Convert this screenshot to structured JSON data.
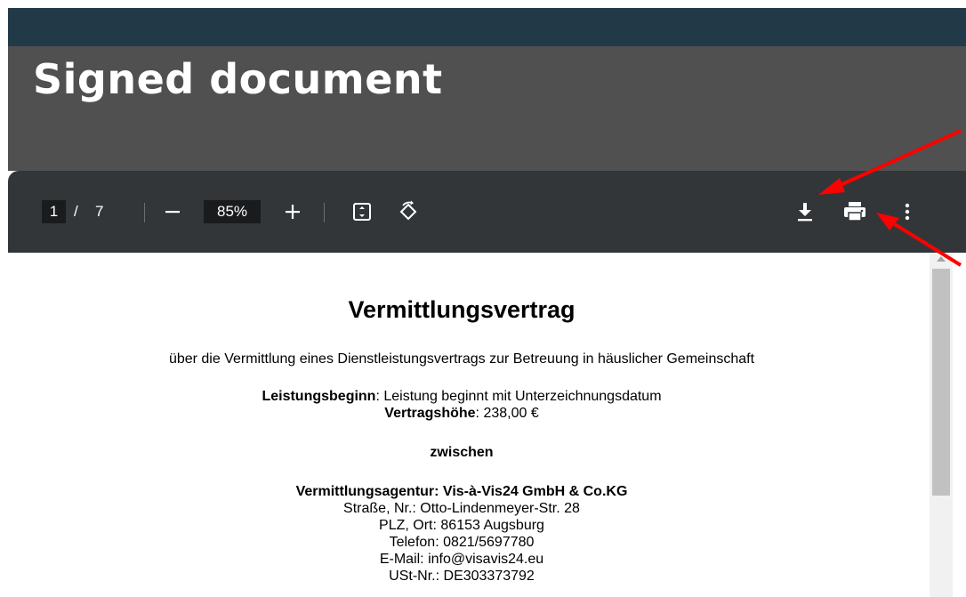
{
  "page": {
    "title": "Signed document"
  },
  "toolbar": {
    "current_page": "1",
    "page_separator": "/",
    "total_pages": "7",
    "zoom": "85%",
    "icons": {
      "zoom_out": "minus-icon",
      "zoom_in": "plus-icon",
      "fit": "fit-page-icon",
      "rotate": "rotate-icon",
      "download": "download-icon",
      "print": "print-icon",
      "more": "more-vertical-icon"
    }
  },
  "document": {
    "title": "Vermittlungsvertrag",
    "subtitle": "über die Vermittlung eines Dienstleistungsvertrags zur Betreuung in häuslicher Gemeinschaft",
    "start_label": "Leistungsbeginn",
    "start_value": ": Leistung beginnt mit Unterzeichnungsdatum",
    "amount_label": "Vertragshöhe",
    "amount_value": ": 238,00 €",
    "between": "zwischen",
    "agency": "Vermittlungsagentur: Vis-à-Vis24 GmbH & Co.KG",
    "street": "Straße, Nr.: Otto-Lindenmeyer-Str. 28",
    "city": "PLZ, Ort: 86153 Augsburg",
    "phone": "Telefon: 0821/5697780",
    "email": "E-Mail: info@visavis24.eu",
    "vat": "USt-Nr.: DE303373792"
  },
  "colors": {
    "top_bar": "#223a47",
    "header": "#505050",
    "viewer": "#323639",
    "annotation_arrow": "#ff0000"
  }
}
